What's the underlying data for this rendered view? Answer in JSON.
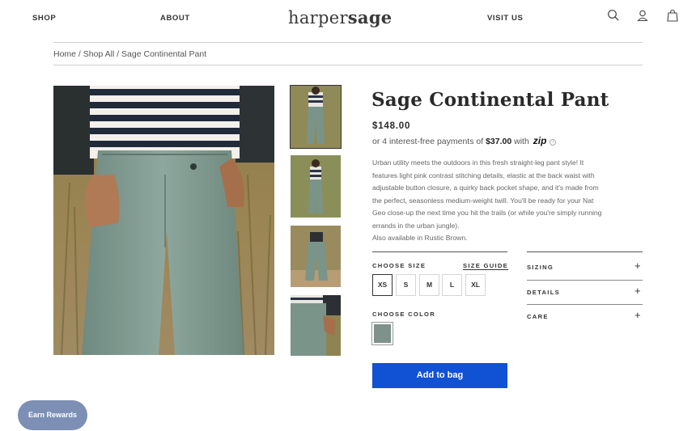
{
  "header": {
    "nav_shop": "SHOP",
    "nav_about": "ABOUT",
    "logo_light": "harper",
    "logo_bold": "sage",
    "nav_visit": "VISIT US",
    "icons": [
      "search-icon",
      "account-icon",
      "bag-icon"
    ]
  },
  "breadcrumb": "Home / Shop All / Sage Continental Pant",
  "product": {
    "title": "Sage Continental Pant",
    "price": "$148.00",
    "installment_prefix": "or 4 interest-free payments of",
    "installment_amount": "$37.00",
    "installment_with": "with",
    "installment_provider": "zip",
    "description_lines": [
      "Urban utility meets the outdoors in this fresh straight-leg pant style! It",
      "features light pink contrast stitching details, elastic at the back waist with",
      "adjustable button closure, a quirky back pocket shape, and it's made from",
      "the perfect, seasonless medium-weight twill. You'll be ready for your Nat",
      "Geo close-up the next time you hit the trails (or while you're simply running",
      "errands in the urban jungle)."
    ],
    "also_available": "Also available in Rustic Brown."
  },
  "options": {
    "size_label": "CHOOSE SIZE",
    "size_guide": "SIZE GUIDE",
    "sizes": [
      "XS",
      "S",
      "M",
      "L",
      "XL"
    ],
    "selected_size": "XS",
    "color_label": "CHOOSE COLOR",
    "selected_color": "#7e918b"
  },
  "accordion": {
    "sizing": "SIZING",
    "details": "DETAILS",
    "care": "CARE"
  },
  "cta": {
    "add_to_bag": "Add to bag"
  },
  "rewards": {
    "label": "Earn Rewards"
  },
  "colors": {
    "accent": "#1151d3",
    "rewards": "#7d8fb4"
  }
}
